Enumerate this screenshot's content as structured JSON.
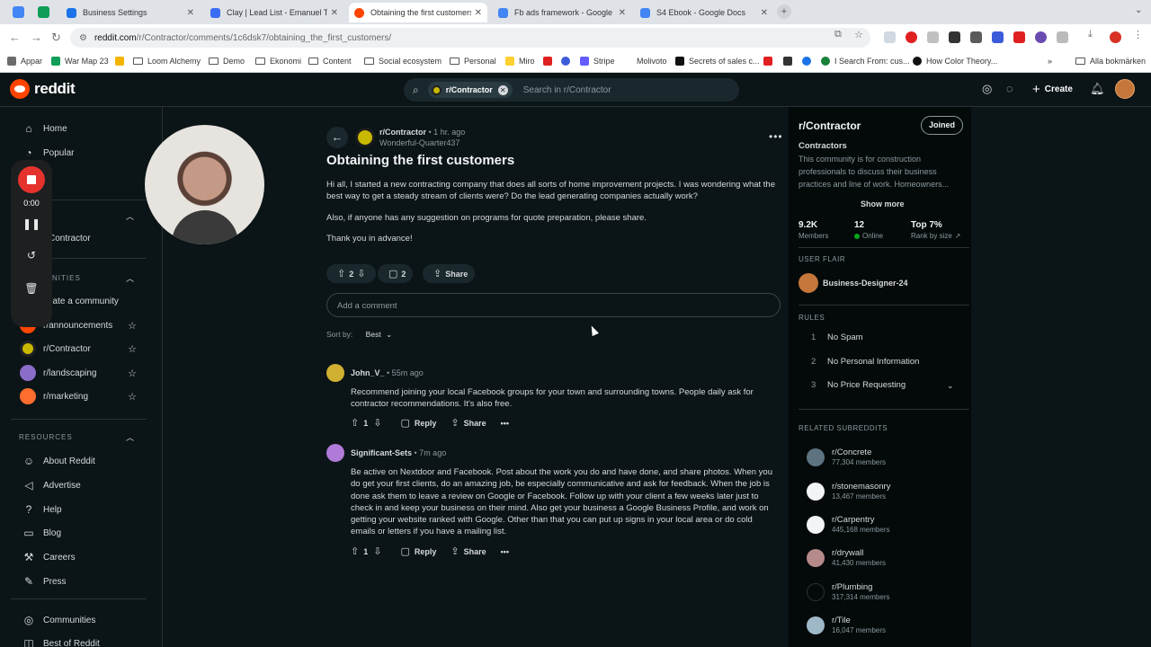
{
  "browser": {
    "tabs": [
      {
        "title": "Business Settings",
        "color": "#1a73e8"
      },
      {
        "title": "Clay | Lead List - Emanuel Th",
        "color": "#3b6cf6"
      },
      {
        "title": "Obtaining the first customers",
        "color": "#ff4500"
      },
      {
        "title": "Fb ads framework - Google D",
        "color": "#4285f4"
      },
      {
        "title": "S4 Ebook - Google Docs",
        "color": "#4285f4"
      }
    ],
    "url_host": "reddit.com",
    "url_path": "/r/Contractor/comments/1c6dsk7/obtaining_the_first_customers/",
    "bookmarks": [
      "Appar",
      "War Map 23",
      "Loom Alchemy",
      "Demo",
      "Ekonomi",
      "Content",
      "Social ecosystem",
      "Personal",
      "Miro",
      "Stripe",
      "Molivoto",
      "Secrets of sales c...",
      "I Search From: cus...",
      "How Color Theory..."
    ],
    "bookmarks_right": "Alla bokmärken"
  },
  "reddit": {
    "logo_text": "reddit",
    "search_chip": "r/Contractor",
    "search_placeholder": "Search in r/Contractor",
    "create_label": "Create"
  },
  "left_nav": {
    "home": "Home",
    "popular": "Popular",
    "contractor_partial": "Contractor",
    "communities_section": "NITIES",
    "create_community": "eate a community",
    "subs": [
      {
        "name": "r/announcements",
        "color": "#ff4500"
      },
      {
        "name": "r/Contractor",
        "color": "#c9b800"
      },
      {
        "name": "r/landscaping",
        "color": "#8a6cc9"
      },
      {
        "name": "r/marketing",
        "color": "#ff6d2e"
      }
    ],
    "resources_section": "RESOURCES",
    "resources": [
      "About Reddit",
      "Advertise",
      "Help",
      "Blog",
      "Careers",
      "Press"
    ],
    "communities": "Communities",
    "best_of": "Best of Reddit"
  },
  "recorder": {
    "time": "0:00"
  },
  "post": {
    "subreddit": "r/Contractor",
    "time": "• 1 hr. ago",
    "author": "Wonderful-Quarter437",
    "title": "Obtaining the first customers",
    "body": [
      "Hi all, I started a new contracting company that does all sorts of home improvement projects. I was wondering what the best way to get a steady stream of clients were? Do the lead generating companies actually work?",
      "Also, if anyone has any suggestion on programs for quote preparation, please share.",
      "Thank you in advance!"
    ],
    "votes": "2",
    "comments": "2",
    "share": "Share",
    "add_comment": "Add a comment",
    "sort_label": "Sort by:",
    "sort_value": "Best"
  },
  "comments": [
    {
      "user": "John_V_",
      "time": "• 55m ago",
      "body": "Recommend joining your local Facebook groups for your town and surrounding towns. People daily ask for contractor recommendations. It's also free.",
      "votes": "1",
      "reply": "Reply",
      "share": "Share"
    },
    {
      "user": "Significant-Sets",
      "time": "• 7m ago",
      "body": "Be active on Nextdoor and Facebook. Post about the work you do and have done, and share photos. When you do get your first clients, do an amazing job, be especially communicative and ask for feedback. When the job is done ask them to leave a review on Google or Facebook. Follow up with your client a few weeks later just to check in and keep your business on their mind. Also get your business a Google Business Profile, and work on getting your website ranked with Google. Other than that you can put up signs in your local area or do cold emails or letters if you have a mailing list.",
      "votes": "1",
      "reply": "Reply",
      "share": "Share"
    }
  ],
  "sidebar": {
    "name": "r/Contractor",
    "joined": "Joined",
    "title": "Contractors",
    "description": "This community is for construction professionals to discuss their business practices and line of work. Homeowners...",
    "show_more": "Show more",
    "members_value": "9.2K",
    "members_label": "Members",
    "online_value": "12",
    "online_label": "Online",
    "rank_value": "Top 7%",
    "rank_label": "Rank by size",
    "user_flair_section": "USER FLAIR",
    "flair_user": "Business-Designer-24",
    "rules_section": "RULES",
    "rules": [
      "No Spam",
      "No Personal Information",
      "No Price Requesting"
    ],
    "related_section": "RELATED SUBREDDITS",
    "related": [
      {
        "name": "r/Concrete",
        "members": "77,304 members",
        "color": "#5d7380"
      },
      {
        "name": "r/stonemasonry",
        "members": "13,467 members",
        "color": "#f2f4f5"
      },
      {
        "name": "r/Carpentry",
        "members": "445,168 members",
        "color": "#f2f4f5"
      },
      {
        "name": "r/drywall",
        "members": "41,430 members",
        "color": "#b58a8a"
      },
      {
        "name": "r/Plumbing",
        "members": "317,314 members",
        "color": "#04090a"
      },
      {
        "name": "r/Tile",
        "members": "16,047 members",
        "color": "#9fb8c8"
      }
    ]
  }
}
